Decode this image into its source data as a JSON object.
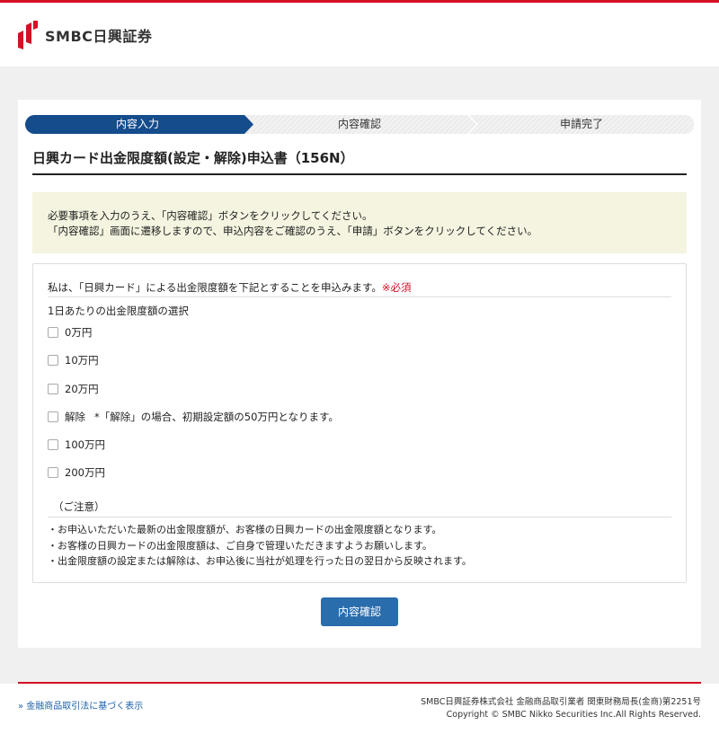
{
  "brand": {
    "name": "SMBC日興証券",
    "accent": "#d50f25"
  },
  "steps": [
    {
      "label": "内容入力",
      "active": true
    },
    {
      "label": "内容確認",
      "active": false
    },
    {
      "label": "申請完了",
      "active": false
    }
  ],
  "page_title": "日興カード出金限度額(設定・解除)申込書（156N）",
  "notice": {
    "line1": "必要事項を入力のうえ、「内容確認」ボタンをクリックしてください。",
    "line2": "「内容確認」画面に遷移しますので、申込内容をご確認のうえ、「申請」ボタンをクリックしてください。"
  },
  "form": {
    "statement": "私は、「日興カード」による出金限度額を下記とすることを申込みます。",
    "required_mark": "※必須",
    "select_label": "1日あたりの出金限度額の選択",
    "options": [
      {
        "label": "0万円",
        "note": ""
      },
      {
        "label": "10万円",
        "note": ""
      },
      {
        "label": "20万円",
        "note": ""
      },
      {
        "label": "解除",
        "note": "*「解除」の場合、初期設定額の50万円となります。"
      },
      {
        "label": "100万円",
        "note": ""
      },
      {
        "label": "200万円",
        "note": ""
      }
    ],
    "caution_title": "（ご注意）",
    "cautions": [
      "・お申込いただいた最新の出金限度額が、お客様の日興カードの出金限度額となります。",
      "・お客様の日興カードの出金限度額は、ご自身で管理いただきますようお願いします。",
      "・出金限度額の設定または解除は、お申込後に当社が処理を行った日の翌日から反映されます。"
    ]
  },
  "confirm_button": "内容確認",
  "footer": {
    "link": "» 金融商品取引法に基づく表示",
    "company": "SMBC日興証券株式会社 金融商品取引業者 関東財務局長(金商)第2251号",
    "copyright": "Copyright © SMBC Nikko Securities Inc.All Rights Reserved."
  }
}
